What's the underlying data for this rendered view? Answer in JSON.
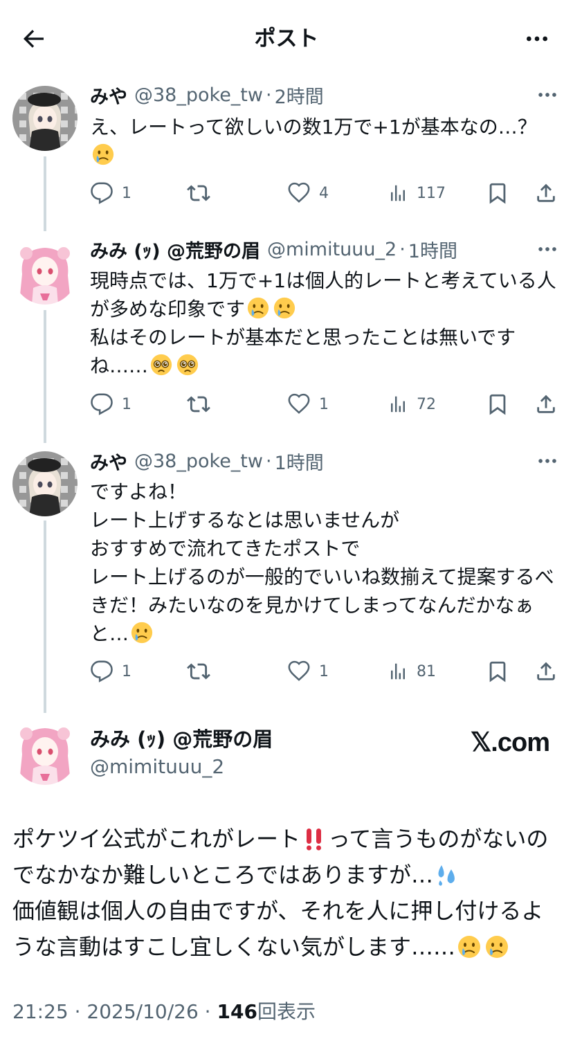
{
  "header": {
    "title": "ポスト"
  },
  "replies": [
    {
      "name": "みや",
      "handle": "@38_poke_tw",
      "separator": "·",
      "time": "2時間",
      "text_lines": [
        "え、レートって欲しいの数1万で+1が基本なの…？"
      ],
      "trailing_emoji": [
        "crying-face"
      ],
      "stats": {
        "replies": "1",
        "reposts": "",
        "likes": "4",
        "views": "117"
      },
      "avatar": "gingham-dark"
    },
    {
      "name": "みみ (ｯ) @荒野の眉",
      "handle": "@mimituuu_2",
      "separator": "·",
      "time": "1時間",
      "text": "現時点では、1万で+1は個人的レートと考えている人が多めな印象です",
      "text2": "私はそのレートが基本だと思ったことは無いですね……",
      "stats": {
        "replies": "1",
        "reposts": "",
        "likes": "1",
        "views": "72"
      },
      "avatar": "pink-girl"
    },
    {
      "name": "みや",
      "handle": "@38_poke_tw",
      "separator": "·",
      "time": "1時間",
      "text": "ですよね！\nレート上げするなとは思いませんが\nおすすめで流れてきたポストで\nレート上げるのが一般的でいいね数揃えて提案するべきだ！みたいなのを見かけてしまってなんだかなぁと…",
      "stats": {
        "replies": "1",
        "reposts": "",
        "likes": "1",
        "views": "81"
      },
      "avatar": "gingham-dark"
    }
  ],
  "main_post": {
    "name": "みみ (ｯ) @荒野の眉",
    "handle": "@mimituuu_2",
    "source": "𝕏.com",
    "line1": "ポケツイ公式がこれがレート",
    "line1b": "って言うものがないのでなかなか難しいところではありますが…",
    "line2": "価値観は個人の自由ですが、それを人に押し付けるような言動はすこし宜しくない気がします……",
    "timestamp": "21:25 · 2025/10/26 · ",
    "views_count": "146",
    "views_label": "回表示"
  },
  "colors": {
    "text": "#0f1419",
    "muted": "#536471",
    "line": "#cfd9de",
    "emphasis": "#e0245e"
  }
}
